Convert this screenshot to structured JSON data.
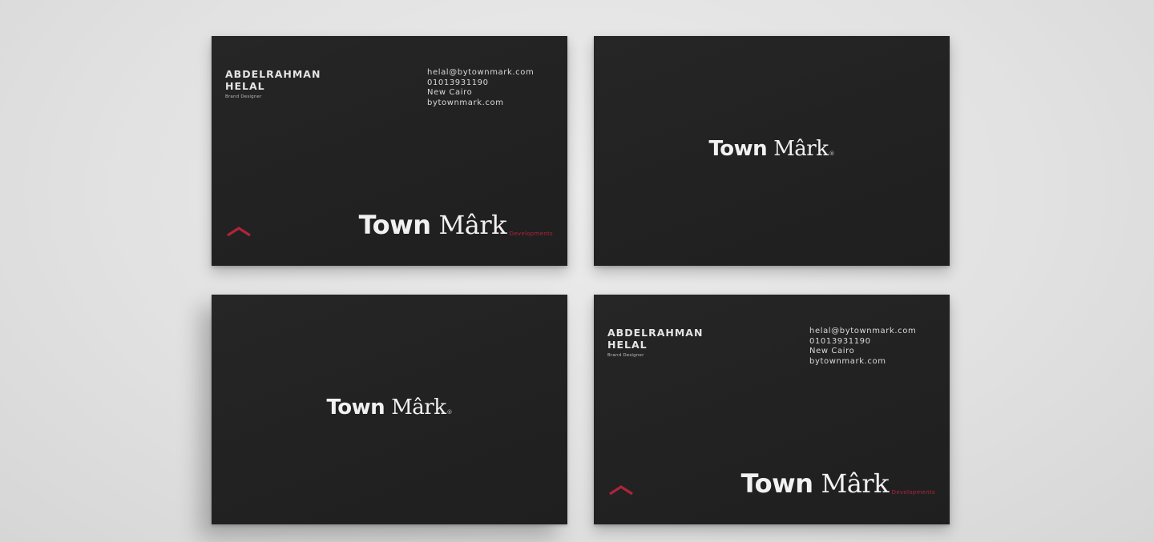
{
  "card_front": {
    "name_line1": "ABDELRAHMAN",
    "name_line2": "HELAL",
    "role": "Brand Designer",
    "email": "helal@bytownmark.com",
    "phone": "01013931190",
    "city": "New Cairo",
    "website": "bytownmark.com"
  },
  "logo": {
    "word1": "Town",
    "word2": "Mârk",
    "tagline": "Developments",
    "registered": "®"
  },
  "colors": {
    "card": "#232323",
    "background": "#e4e4e4",
    "accent": "#b0243a",
    "text": "#f1f1f1"
  },
  "icons": {
    "chevron": "chevron-up-icon"
  }
}
